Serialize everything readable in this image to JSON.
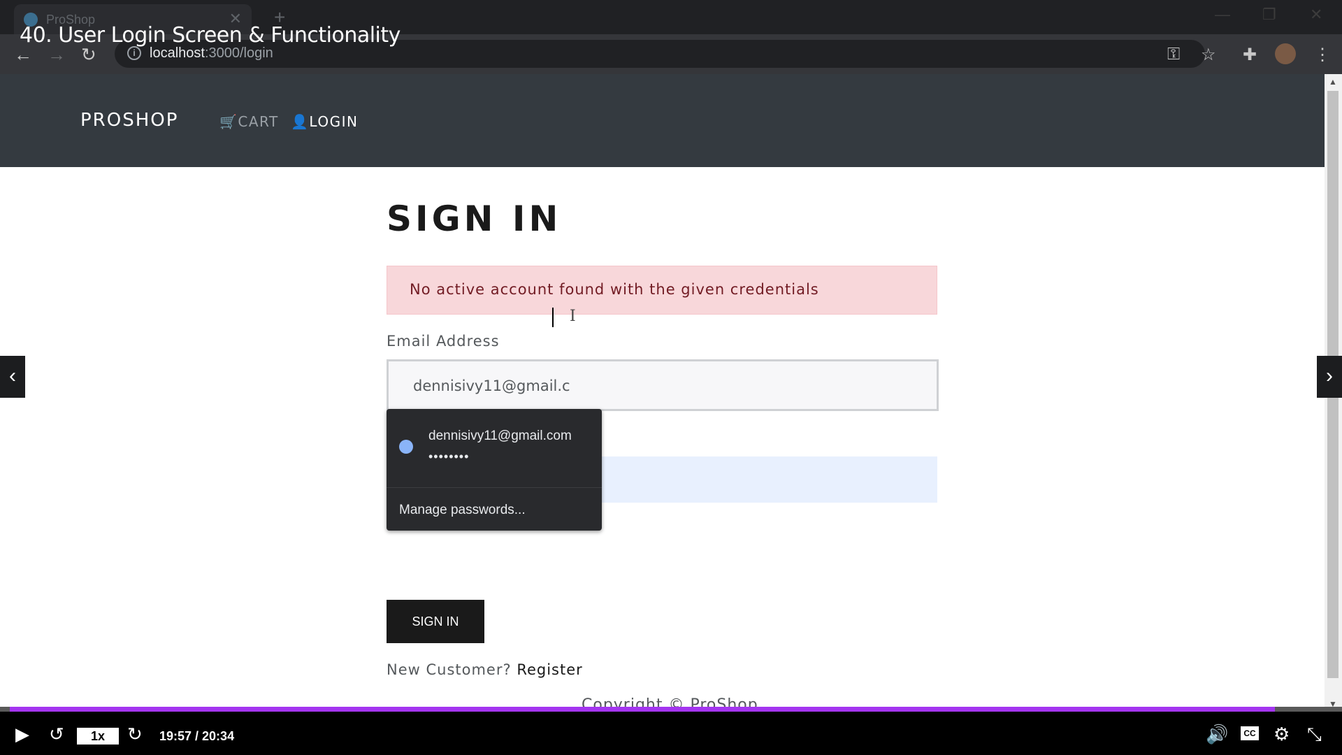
{
  "browser": {
    "tab_title": "ProShop",
    "tab_close": "✕",
    "new_tab": "+",
    "url_host": "localhost",
    "url_path": ":3000/login",
    "window_buttons": [
      "—",
      "❐",
      "✕"
    ]
  },
  "video": {
    "title": "40. User Login Screen & Functionality",
    "speed": "1x",
    "time": "19:57 / 20:34",
    "progress": 0.97,
    "cc_label": "CC"
  },
  "navbar": {
    "brand": "PROSHOP",
    "cart": "CART",
    "login": "LOGIN"
  },
  "login": {
    "heading": "SIGN IN",
    "alert": "No active account found with the given credentials",
    "email_label": "Email Address",
    "email_value": "dennisivy11@gmail.c",
    "sign_in_button": "SIGN IN",
    "new_customer": "New Customer?",
    "register": "Register",
    "copyright": "Copyright © ProShop"
  },
  "autofill": {
    "email": "dennisivy11@gmail.com",
    "password_mask": "••••••••",
    "manage": "Manage passwords..."
  },
  "colors": {
    "navbar": "#343a40",
    "alert_bg": "#f8d7da",
    "alert_text": "#721c24",
    "progress": "#a435f0"
  }
}
